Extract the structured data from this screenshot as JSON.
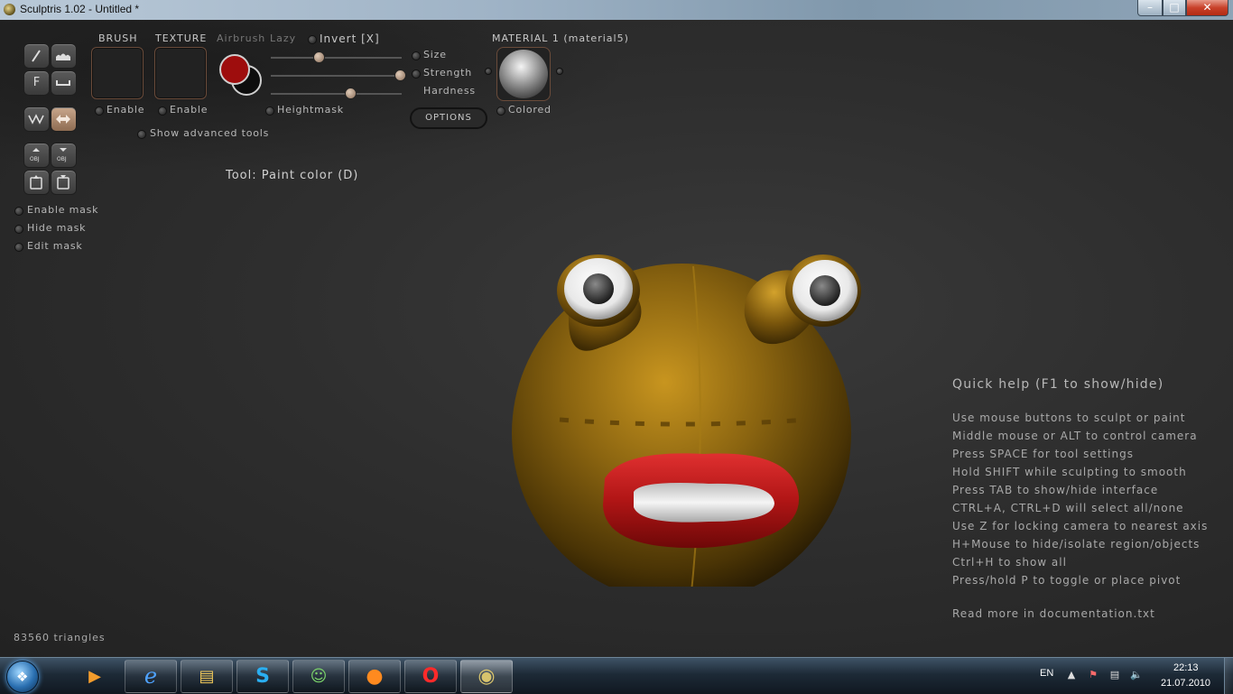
{
  "window": {
    "title": "Sculptris 1.02 - Untitled *",
    "min_label": "–",
    "max_label": "□",
    "close_label": "✕"
  },
  "tools": {
    "draw_label": "F"
  },
  "brush": {
    "label": "BRUSH",
    "enable_label": "Enable"
  },
  "texture": {
    "label": "TEXTURE",
    "enable_label": "Enable"
  },
  "airbrush_label": "Airbrush",
  "lazy_label": "Lazy",
  "invert_label": "Invert [X]",
  "heightmask_label": "Heightmask",
  "show_advanced_label": "Show advanced tools",
  "sliders": {
    "size_label": "Size",
    "strength_label": "Strength",
    "hardness_label": "Hardness",
    "size_value": 0.36,
    "strength_value": 0.98,
    "hardness_value": 0.6
  },
  "options_label": "OPTIONS",
  "material": {
    "label": "MATERIAL 1 (material5)",
    "colored_label": "Colored"
  },
  "colors": {
    "primary": "#9e0d0d",
    "secondary": "#0d0d0d",
    "model": "#8a6410",
    "lips": "#b01515"
  },
  "mask": {
    "enable_label": "Enable mask",
    "hide_label": "Hide mask",
    "edit_label": "Edit mask"
  },
  "tool_label": "Tool: Paint color (D)",
  "quick_help": {
    "title": "Quick help (F1 to show/hide)",
    "lines": [
      "Use mouse buttons to sculpt or paint",
      "Middle mouse or ALT to control camera",
      "Press SPACE for tool settings",
      "Hold SHIFT while sculpting to smooth",
      "Press TAB to show/hide interface",
      "CTRL+A, CTRL+D will select all/none",
      "Use Z for locking camera to nearest axis",
      "H+Mouse to hide/isolate region/objects",
      "Ctrl+H to show all",
      "Press/hold P to toggle or place pivot"
    ],
    "more": "Read more in documentation.txt"
  },
  "status": {
    "triangles": "83560 triangles"
  },
  "taskbar": {
    "apps": [
      {
        "name": "media-player",
        "icon": "▶"
      },
      {
        "name": "internet-explorer",
        "icon": "e"
      },
      {
        "name": "explorer",
        "icon": "▤"
      },
      {
        "name": "skype",
        "icon": "S"
      },
      {
        "name": "messenger",
        "icon": "☺"
      },
      {
        "name": "firefox",
        "icon": "●"
      },
      {
        "name": "opera",
        "icon": "O"
      },
      {
        "name": "sculptris",
        "icon": "◉"
      }
    ],
    "lang": "EN",
    "time": "22:13",
    "date": "21.07.2010"
  }
}
